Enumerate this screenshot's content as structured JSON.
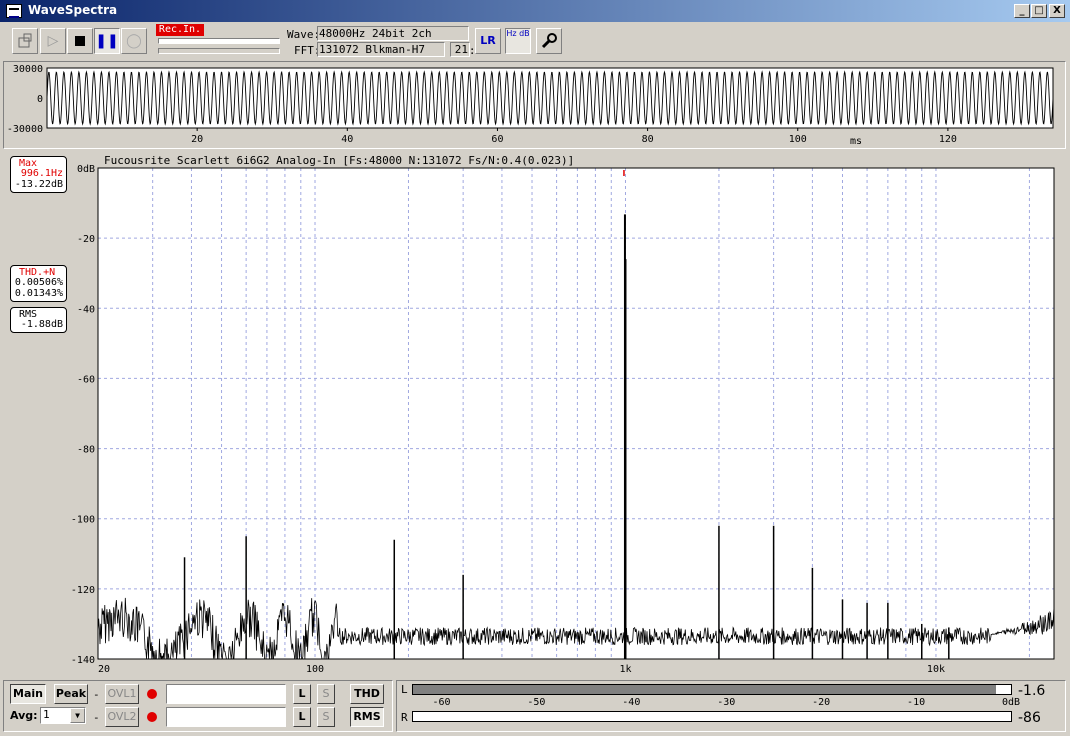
{
  "window": {
    "title": "WaveSpectra",
    "minimize": "_",
    "maximize": "□",
    "close": "X"
  },
  "toolbar": {
    "rec_in": "Rec.In.",
    "wave_label": "Wave:",
    "wave_value": "48000Hz 24bit 2ch",
    "fft_label": "FFT:",
    "fft_value": "131072 Blkman-H7",
    "fps_label": "fps:",
    "fps_value": "21",
    "lr_button": "LR",
    "hz_db_button": "Hz dB"
  },
  "wave": {
    "y_ticks": [
      "30000",
      "0",
      "-30000"
    ],
    "x_ticks": [
      "20",
      "40",
      "60",
      "80",
      "100",
      "120"
    ],
    "x_values": [
      20,
      40,
      60,
      80,
      100,
      120
    ],
    "x_unit": "ms",
    "x_range": [
      0,
      134
    ],
    "cycles": 134
  },
  "readouts": {
    "max_label": "Max",
    "max_freq": "996.1Hz",
    "max_db": "-13.22dB",
    "thd_label": "THD.+N",
    "thd_value1": "0.00506%",
    "thd_value2": "0.01343%",
    "rms_label": "RMS",
    "rms_value": "-1.88dB"
  },
  "spectrum_header": "Fucousrite Scarlett 6i6G2 Analog-In  [Fs:48000 N:131072 Fs/N:0.4(0.023)]",
  "chart_data": {
    "type": "line",
    "title": "Fucousrite Scarlett 6i6G2 Analog-In  [Fs:48000 N:131072 Fs/N:0.4(0.023)]",
    "xscale": "log",
    "xlim": [
      20,
      24000
    ],
    "ylim": [
      -140,
      0
    ],
    "y_ticks": [
      0,
      -20,
      -40,
      -60,
      -80,
      -100,
      -120,
      -140
    ],
    "y_tick_labels": [
      "0dB",
      "-20",
      "-40",
      "-60",
      "-80",
      "-100",
      "-120",
      "-140"
    ],
    "x_ticks": [
      20,
      100,
      1000,
      10000
    ],
    "x_tick_labels": [
      "20",
      "100",
      "1k",
      "10k"
    ],
    "grid": true,
    "peaks": [
      {
        "f": 38,
        "db": -111
      },
      {
        "f": 60,
        "db": -105
      },
      {
        "f": 180,
        "db": -106
      },
      {
        "f": 300,
        "db": -116
      },
      {
        "f": 996.1,
        "db": -13.22
      },
      {
        "f": 1000,
        "db": -26
      },
      {
        "f": 2000,
        "db": -102
      },
      {
        "f": 3000,
        "db": -102
      },
      {
        "f": 4000,
        "db": -114
      },
      {
        "f": 5000,
        "db": -123
      },
      {
        "f": 6000,
        "db": -124
      },
      {
        "f": 7000,
        "db": -124
      },
      {
        "f": 9000,
        "db": -130
      },
      {
        "f": 11000,
        "db": -131
      }
    ],
    "noise_floor_db": -136
  },
  "bottom": {
    "main_button": "Main",
    "peak_button": "Peak",
    "avg_label": "Avg:",
    "avg_value": "1",
    "ovl1": "OVL1",
    "ovl2": "OVL2",
    "dash": "-",
    "l_button": "L",
    "s_button": "S",
    "thd_button": "THD",
    "rms_button": "RMS"
  },
  "level_meter": {
    "l_label": "L",
    "r_label": "R",
    "ticks": [
      "-60",
      "-50",
      "-40",
      "-30",
      "-20",
      "-10",
      "0dB"
    ],
    "tick_values": [
      -60,
      -50,
      -40,
      -30,
      -20,
      -10,
      0
    ],
    "range": [
      -63,
      0
    ],
    "l_value": "-1.6",
    "r_value": "-86",
    "l_level_db": -1.6,
    "r_level_db": -86
  },
  "colors": {
    "window_bg": "#d4d0c8",
    "grid": "#a0a8e0",
    "trace": "#000000",
    "marker": "#e00000",
    "titlebar": "#0a246a"
  }
}
